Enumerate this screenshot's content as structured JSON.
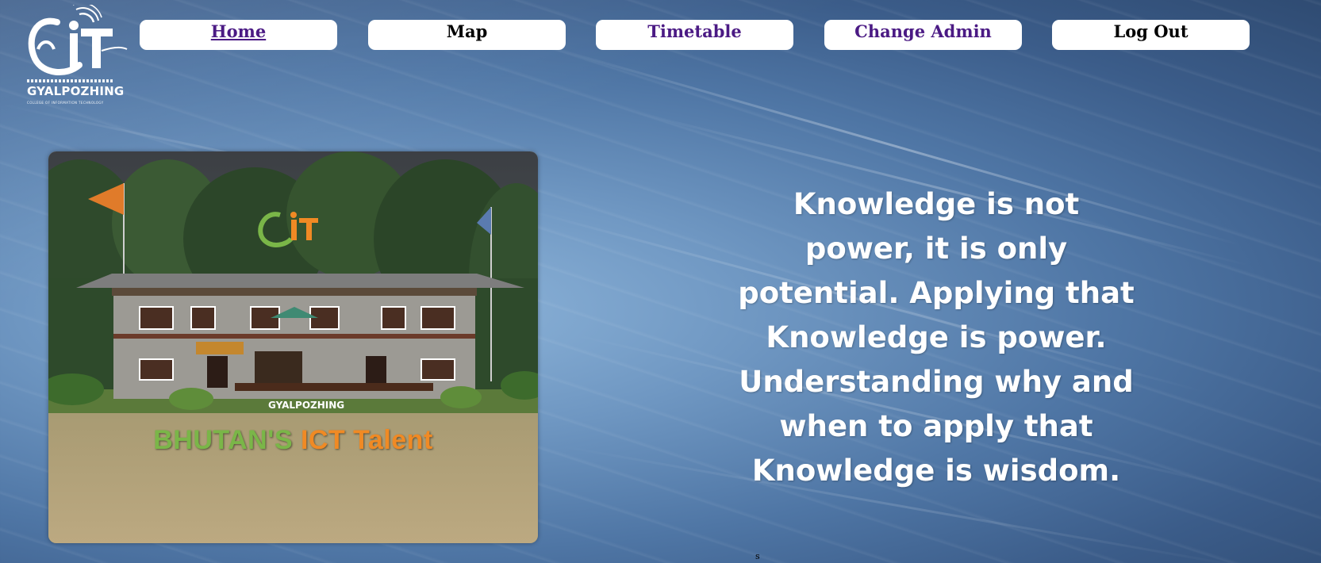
{
  "logo": {
    "brand_letters": "CIT",
    "name": "GYALPOZHING",
    "subtitle": "COLLEGE OF INFORMATION TECHNOLOGY",
    "colors": {
      "primary": "#ffffff"
    }
  },
  "nav": {
    "items": [
      {
        "label": "Home",
        "state": "active"
      },
      {
        "label": "Map",
        "state": "normal"
      },
      {
        "label": "Timetable",
        "state": "visited"
      },
      {
        "label": "Change Admin",
        "state": "visited"
      },
      {
        "label": "Log Out",
        "state": "normal"
      }
    ],
    "colors": {
      "link_visited": "#4b1a84",
      "button_bg": "#ffffff"
    }
  },
  "hero": {
    "logo_name": "GYALPOZHING",
    "title_part1": "BHUTAN'S",
    "title_part2": "ICT Talent",
    "colors": {
      "green": "#7ab648",
      "orange": "#f08a24"
    }
  },
  "quote": {
    "text": "Knowledge is not power, it is only potential. Applying that Knowledge is power. Understanding why and when to apply that Knowledge is wisdom."
  },
  "stray_text": "s"
}
